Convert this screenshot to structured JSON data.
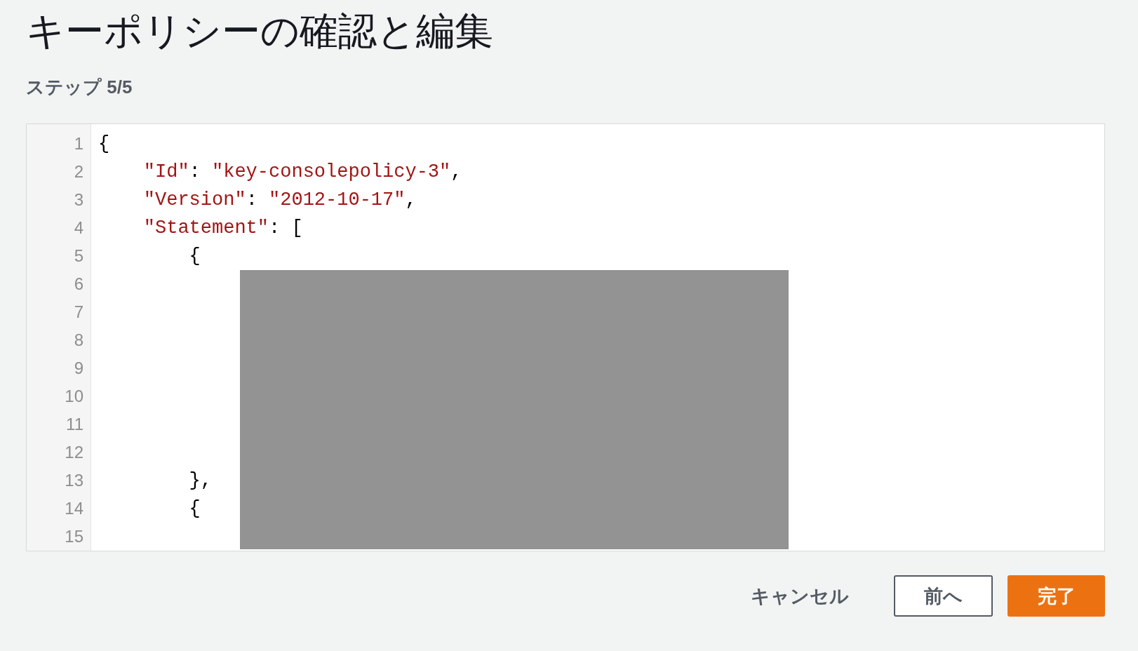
{
  "page": {
    "title": "キーポリシーの確認と編集",
    "step": "ステップ 5/5"
  },
  "editor": {
    "redacted": true,
    "lines": [
      {
        "number": "1",
        "tokens": [
          {
            "kind": "punct",
            "text": "{"
          }
        ],
        "children": [
          {
            "number": "2",
            "tokens": [
              {
                "kind": "key",
                "text": "\"Id\""
              },
              {
                "kind": "punct",
                "text": ": "
              },
              {
                "kind": "string",
                "text": "\"key-consolepolicy-3\""
              },
              {
                "kind": "punct",
                "text": ","
              }
            ]
          },
          {
            "number": "3",
            "tokens": [
              {
                "kind": "key",
                "text": "\"Version\""
              },
              {
                "kind": "punct",
                "text": ": "
              },
              {
                "kind": "string",
                "text": "\"2012-10-17\""
              },
              {
                "kind": "punct",
                "text": ","
              }
            ]
          },
          {
            "number": "4",
            "tokens": [
              {
                "kind": "key",
                "text": "\"Statement\""
              },
              {
                "kind": "punct",
                "text": ": ["
              }
            ],
            "children": [
              {
                "number": "5",
                "tokens": [
                  {
                    "kind": "punct",
                    "text": "{"
                  }
                ],
                "children": [
                  {
                    "number": "6"
                  },
                  {
                    "number": "7"
                  },
                  {
                    "number": "8"
                  },
                  {
                    "number": "9"
                  },
                  {
                    "number": "10"
                  },
                  {
                    "number": "11"
                  },
                  {
                    "number": "12"
                  }
                ]
              },
              {
                "number": "13",
                "tokens": [
                  {
                    "kind": "punct",
                    "text": "},"
                  }
                ]
              },
              {
                "number": "14",
                "tokens": [
                  {
                    "kind": "punct",
                    "text": "{"
                  }
                ],
                "children": [
                  {
                    "number": "15"
                  }
                ]
              }
            ]
          }
        ]
      }
    ]
  },
  "buttons": [
    {
      "kind": "link",
      "label": "キャンセル"
    },
    {
      "kind": "secondary",
      "label": "前へ"
    },
    {
      "kind": "primary",
      "label": "完了"
    }
  ]
}
